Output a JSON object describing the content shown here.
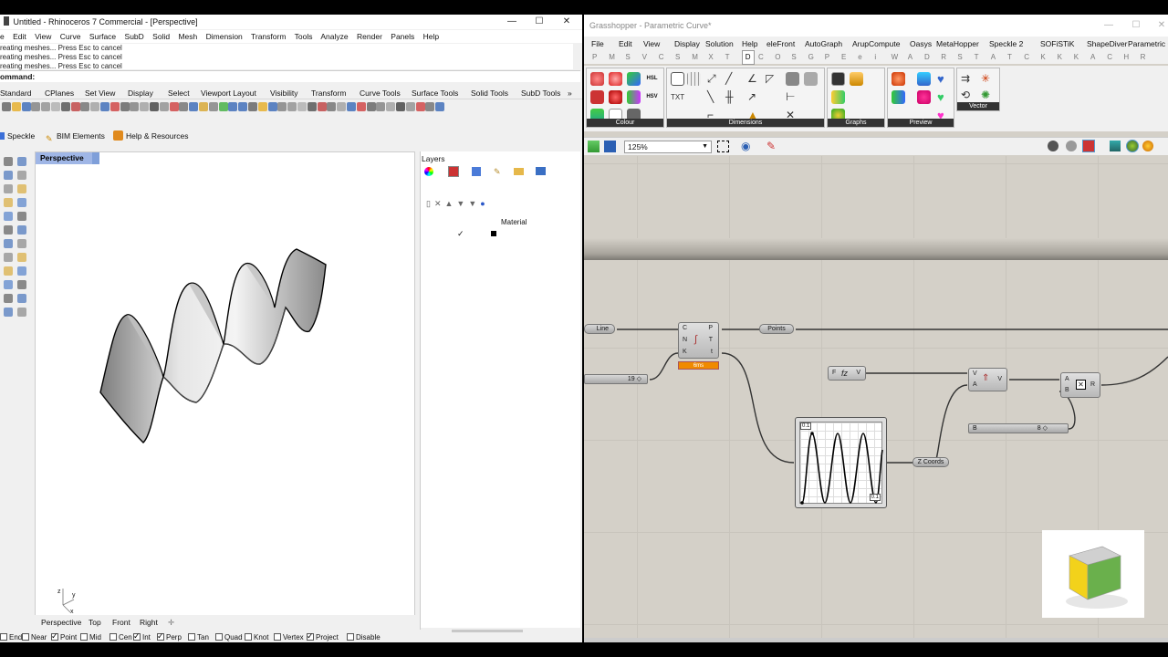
{
  "rhino": {
    "title": "Untitled - Rhinoceros 7 Commercial - [Perspective]",
    "menu": [
      "e",
      "Edit",
      "View",
      "Curve",
      "Surface",
      "SubD",
      "Solid",
      "Mesh",
      "Dimension",
      "Transform",
      "Tools",
      "Analyze",
      "Render",
      "Panels",
      "Help"
    ],
    "command_history": [
      "reating meshes... Press Esc to cancel",
      "reating meshes... Press Esc to cancel",
      "reating meshes... Press Esc to cancel"
    ],
    "command_label": "ommand:",
    "toolbar_tabs": [
      "Standard",
      "CPlanes",
      "Set View",
      "Display",
      "Select",
      "Viewport Layout",
      "Visibility",
      "Transform",
      "Curve Tools",
      "Surface Tools",
      "Solid Tools",
      "SubD Tools"
    ],
    "plugin_tabs": [
      "Speckle",
      "BIM Elements",
      "Help & Resources"
    ],
    "viewport_name": "Perspective",
    "axes": {
      "z": "z",
      "y": "y",
      "x": "x"
    },
    "view_tabs": [
      "Perspective",
      "Top",
      "Front",
      "Right"
    ],
    "layers_title": "Layers",
    "layers_column": "Material",
    "osnaps": [
      {
        "label": "End",
        "on": false
      },
      {
        "label": "Near",
        "on": false
      },
      {
        "label": "Point",
        "on": true
      },
      {
        "label": "Mid",
        "on": false
      },
      {
        "label": "Cen",
        "on": false
      },
      {
        "label": "Int",
        "on": true
      },
      {
        "label": "Perp",
        "on": true
      },
      {
        "label": "Tan",
        "on": false
      },
      {
        "label": "Quad",
        "on": false
      },
      {
        "label": "Knot",
        "on": false
      },
      {
        "label": "Vertex",
        "on": false
      },
      {
        "label": "Project",
        "on": true
      },
      {
        "label": "Disable",
        "on": false
      }
    ]
  },
  "gh": {
    "title": "Grasshopper - Parametric Curve*",
    "menu": [
      "File",
      "Edit",
      "View",
      "Display",
      "Solution",
      "Help",
      "eleFront",
      "AutoGraph",
      "ArupCompute",
      "Oasys",
      "MetaHopper",
      "Speckle 2",
      "SOFiSTiK",
      "ShapeDiver",
      "Parametric Cur"
    ],
    "tabs": [
      "P",
      "M",
      "S",
      "V",
      "C",
      "S",
      "M",
      "X",
      "T",
      "D",
      "C",
      "O",
      "S",
      "G",
      "P",
      "E",
      "e",
      "i",
      "W",
      "A",
      "D",
      "R",
      "S",
      "T",
      "A",
      "T",
      "C",
      "K",
      "K",
      "K",
      "A",
      "C",
      "H",
      "R"
    ],
    "active_tab": "D",
    "panels": [
      "Colour",
      "Dimensions",
      "Graphs",
      "Preview",
      "Vector"
    ],
    "ribbon_labels": {
      "hsl": "HSL",
      "hsv": "HSV"
    },
    "zoom": "125%",
    "nodes": {
      "line": "Line",
      "slider_value": "19",
      "cnk_ports": [
        "C",
        "N",
        "K"
      ],
      "cnk_outputs": [
        "P",
        "T",
        "t"
      ],
      "time": "6ms",
      "points": "Points",
      "func_in": "F",
      "func_out": "V",
      "vec_in": [
        "V",
        "A"
      ],
      "vec_out": "V",
      "mul_in": [
        "A",
        "B"
      ],
      "mul_out": "R",
      "slider_b_label": "B",
      "slider_b_value": "8",
      "graph_min": "0.1",
      "graph_max": "0.1",
      "zcoords": "Z Coords"
    }
  }
}
